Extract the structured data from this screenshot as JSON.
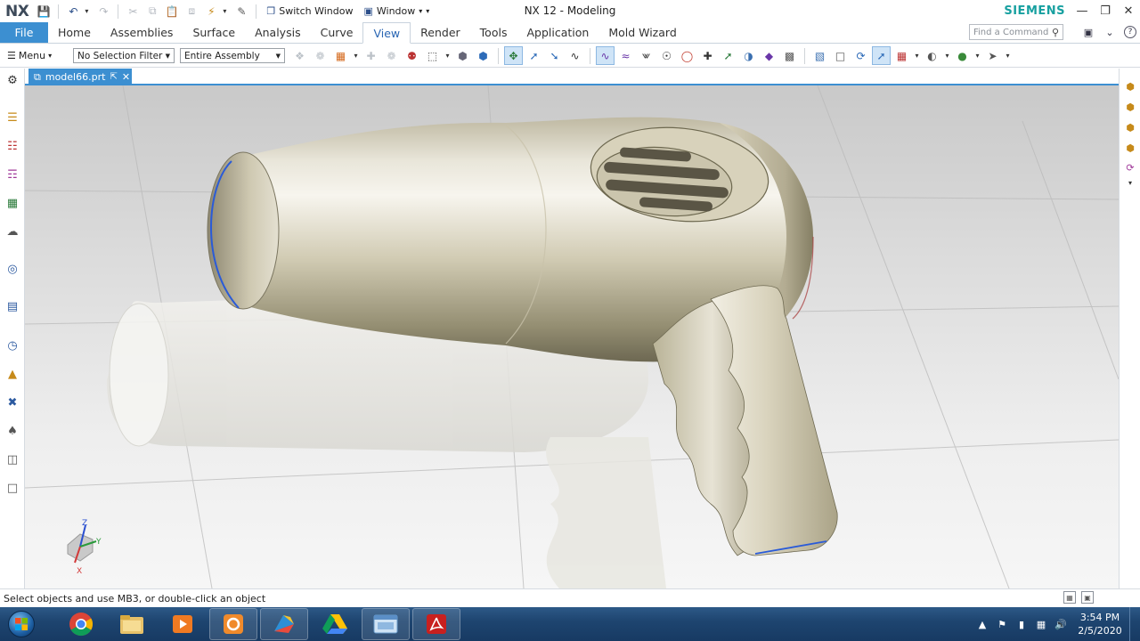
{
  "app": {
    "logo": "NX",
    "title": "NX 12 - Modeling",
    "brand": "SIEMENS"
  },
  "quick_access": {
    "switch_window_label": "Switch Window",
    "window_label": "Window"
  },
  "ribbon": {
    "tabs": [
      "File",
      "Home",
      "Assemblies",
      "Surface",
      "Analysis",
      "Curve",
      "View",
      "Render",
      "Tools",
      "Application",
      "Mold Wizard"
    ],
    "active_tab": "View",
    "find_command_placeholder": "Find a Command"
  },
  "toolbar": {
    "menu_label": "Menu",
    "selection_filter": "No Selection Filter",
    "assembly_scope": "Entire Assembly"
  },
  "document": {
    "tab_name": "model66.prt"
  },
  "viewport": {
    "triad_labels": {
      "x": "X",
      "y": "Y",
      "z": "Z"
    }
  },
  "status": {
    "message": "Select objects and use MB3, or double-click an object"
  },
  "taskbar": {
    "time": "3:54 PM",
    "date": "2/5/2020"
  },
  "colors": {
    "file_tab": "#3c8fd1",
    "active_tab_text": "#2a66b3",
    "brand": "#17a0a0",
    "model_surface": "#d9d4c0",
    "selected_edge": "#2a5bd8"
  }
}
